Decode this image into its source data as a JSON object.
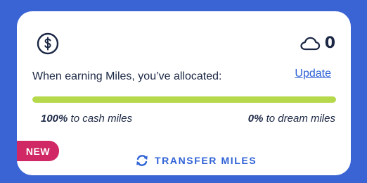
{
  "colors": {
    "background": "#3a63d3",
    "card": "#ffffff",
    "text": "#1b2744",
    "link": "#2f62d6",
    "progress_fill": "#b5d94a",
    "badge": "#cf2865"
  },
  "icons": {
    "top_left": "dollar-circle-icon",
    "top_right": "cloud-icon",
    "transfer": "swap-arrows-icon"
  },
  "dream": {
    "count": "0"
  },
  "allocation": {
    "prompt": "When earning Miles, you’ve allocated:",
    "update_label": "Update",
    "cash_percent": 100,
    "cash_value": "100%",
    "cash_suffix": " to cash miles",
    "dream_value": "0%",
    "dream_suffix": " to dream miles"
  },
  "badge": {
    "label": "NEW"
  },
  "transfer": {
    "label": "TRANSFER MILES"
  }
}
